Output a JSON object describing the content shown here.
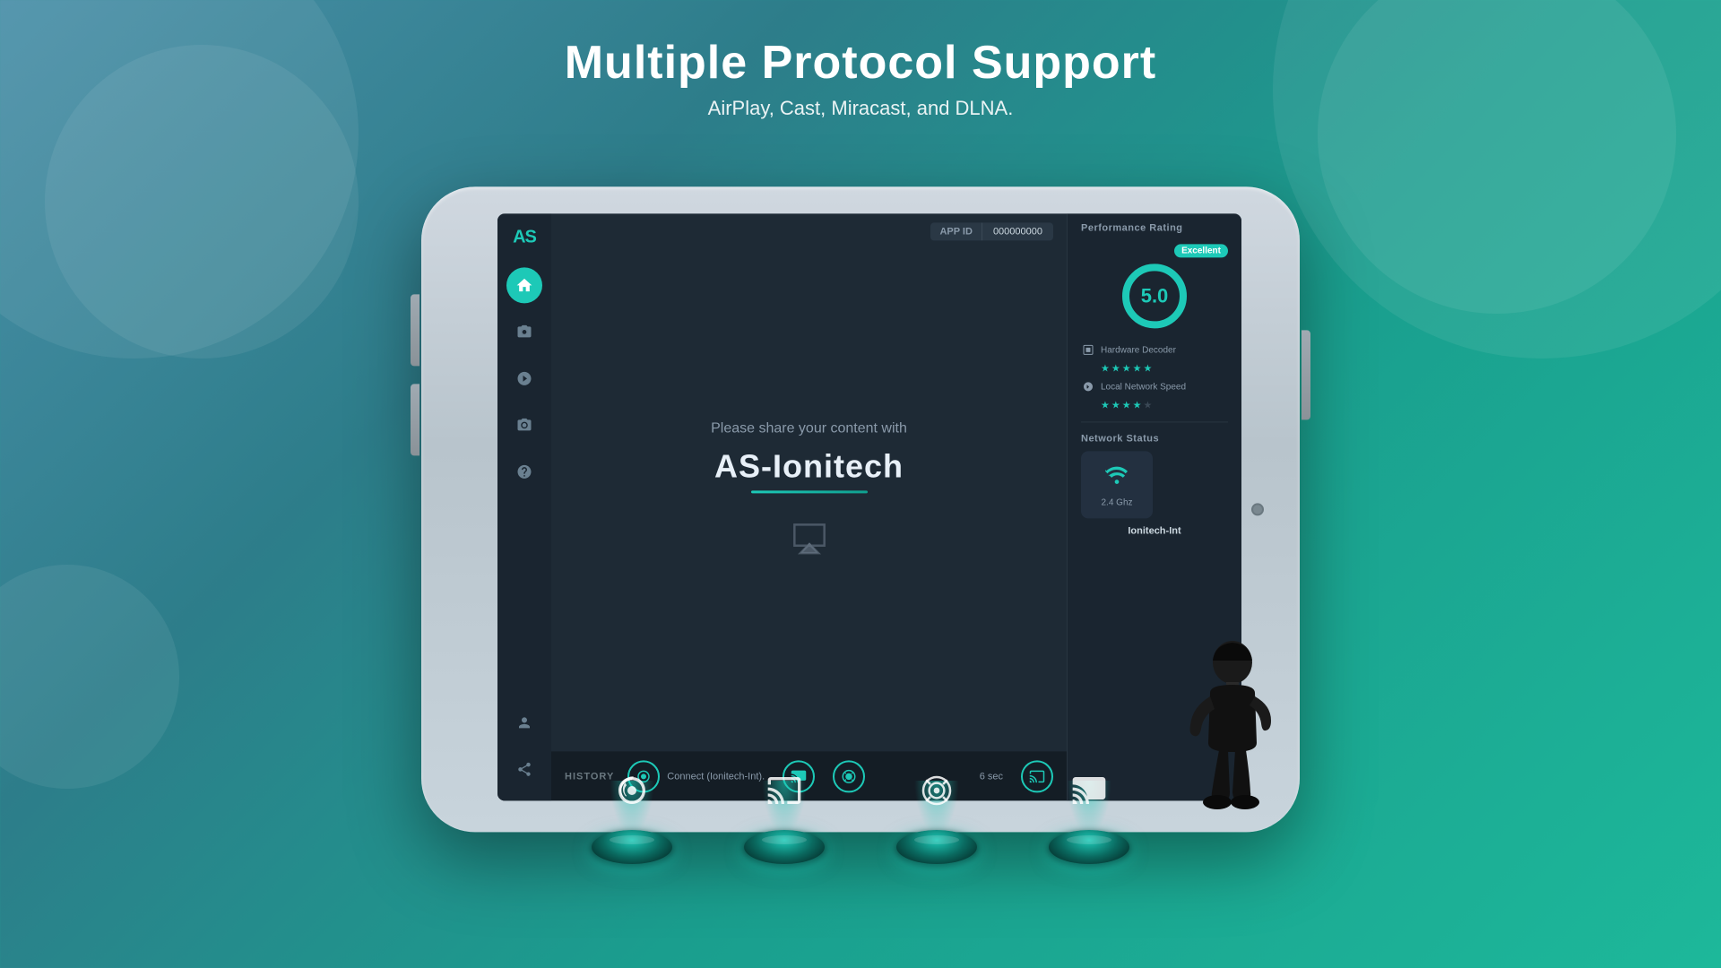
{
  "header": {
    "title": "Multiple Protocol Support",
    "subtitle": "AirPlay, Cast, Miracast, and DLNA."
  },
  "app_bar": {
    "app_id_label": "APP ID",
    "app_id_value": "000000000"
  },
  "sidebar": {
    "logo": "AS",
    "icons": [
      {
        "name": "home",
        "symbol": "⌂",
        "active": true
      },
      {
        "name": "camera",
        "symbol": "⊙"
      },
      {
        "name": "record",
        "symbol": "⏺"
      },
      {
        "name": "screenshot",
        "symbol": "◎"
      },
      {
        "name": "help",
        "symbol": "?"
      }
    ],
    "bottom_icons": [
      {
        "name": "user",
        "symbol": "👤"
      },
      {
        "name": "share",
        "symbol": "↗"
      }
    ]
  },
  "main": {
    "share_prompt": "Please share your content with",
    "device_name": "AS-Ionitech"
  },
  "performance": {
    "section_title": "Performance Rating",
    "badge": "Excellent",
    "score": "5.0",
    "hardware_decoder_label": "Hardware Decoder",
    "hardware_stars": 5,
    "network_speed_label": "Local Network Speed",
    "network_stars": 4
  },
  "network": {
    "section_title": "Network Status",
    "wifi_freq": "2.4 Ghz",
    "wifi_name": "Ionitech-Int"
  },
  "history": {
    "label": "HISTORY",
    "items": [
      {
        "name": "AirPlay",
        "text": "Connect (Ionitech-Int)."
      },
      {
        "name": "Cast",
        "text": ""
      },
      {
        "name": "Miracast",
        "text": ""
      },
      {
        "name": "DLNA",
        "text": ""
      }
    ],
    "timer": "6 sec"
  },
  "pads": [
    {
      "protocol": "AirPlay"
    },
    {
      "protocol": "Cast"
    },
    {
      "protocol": "Miracast"
    },
    {
      "protocol": "DLNA"
    }
  ],
  "colors": {
    "teal": "#1dc9b7",
    "dark_bg": "#1e2a35",
    "sidebar_bg": "#1a2530",
    "panel_bg": "#1a2530"
  }
}
